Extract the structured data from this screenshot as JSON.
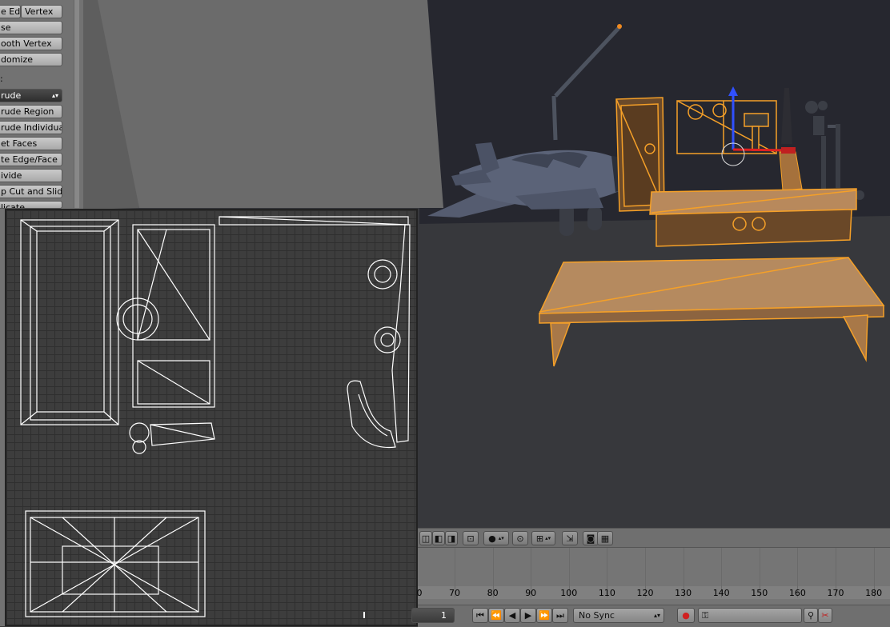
{
  "tool_panel": {
    "row1_left": "e Ed",
    "row1_right": "Vertex",
    "items": [
      "se",
      "ooth Vertex",
      "domize"
    ],
    "section_label": ":",
    "extrude_dropdown": "rude",
    "extrude_items": [
      "rude Region",
      "rude Individual",
      "et Faces",
      "te Edge/Face",
      "ivide",
      "p Cut and Slide",
      "licate"
    ]
  },
  "timeline": {
    "ruler_labels": [
      "70",
      "80",
      "90",
      "100",
      "110",
      "120",
      "130",
      "140",
      "150",
      "160",
      "170",
      "180"
    ],
    "first_partial_label": "0",
    "current_frame": "1",
    "sync_mode": "No Sync"
  },
  "colors": {
    "selection_orange": "#f5a028",
    "selected_face_fill": "#b58a5f",
    "airplane_body": "#5b6378",
    "uv_wire": "#ffffff"
  },
  "icons": {
    "playback": [
      "jump-start-icon",
      "prev-keyframe-icon",
      "play-reverse-icon",
      "play-icon",
      "next-keyframe-icon",
      "jump-end-icon"
    ],
    "record": "record-icon",
    "keying": "keying-set-icon"
  }
}
